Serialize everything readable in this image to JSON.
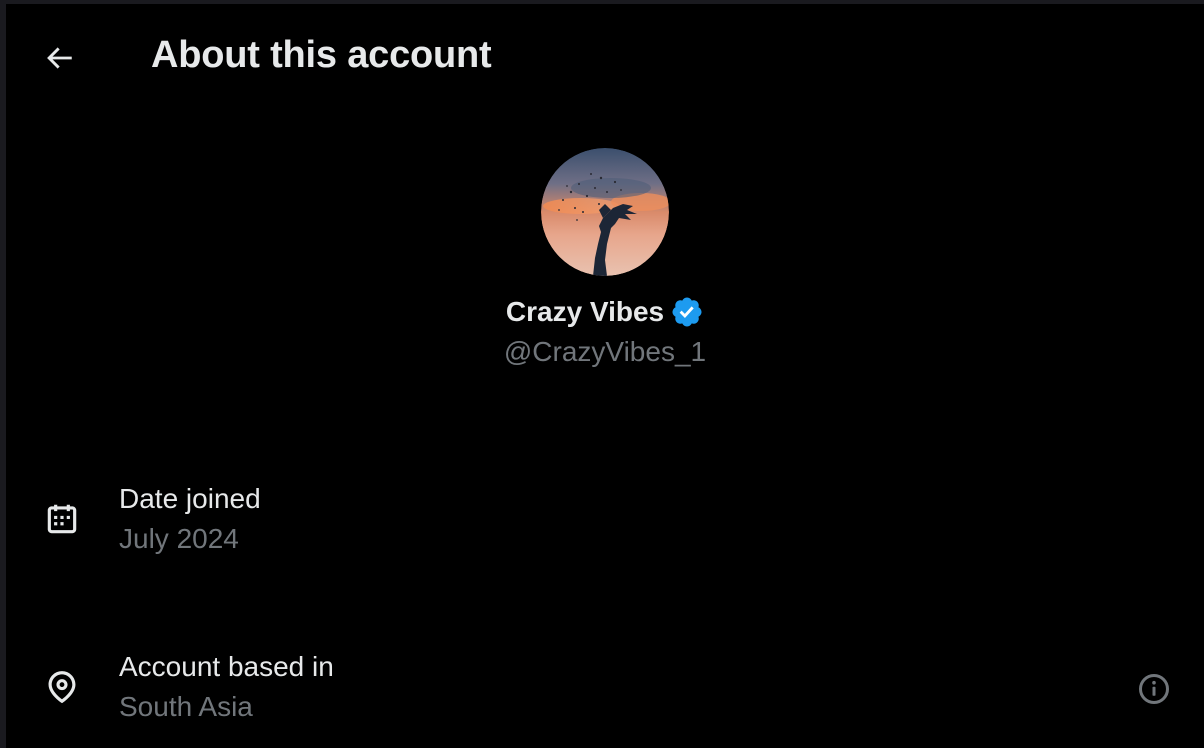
{
  "header": {
    "title": "About this account",
    "back_icon": "arrow-left-icon"
  },
  "profile": {
    "display_name": "Crazy Vibes",
    "handle": "@CrazyVibes_1",
    "verified": true,
    "verified_color": "#1d9bf0"
  },
  "details": {
    "date_joined": {
      "label": "Date joined",
      "value": "July 2024",
      "icon": "calendar-icon"
    },
    "account_based_in": {
      "label": "Account based in",
      "value": "South Asia",
      "icon": "location-pin-icon",
      "info_icon": "info-icon"
    }
  },
  "colors": {
    "background": "#000000",
    "primary_text": "#e7e9ea",
    "secondary_text": "#71767b",
    "accent": "#1d9bf0"
  }
}
